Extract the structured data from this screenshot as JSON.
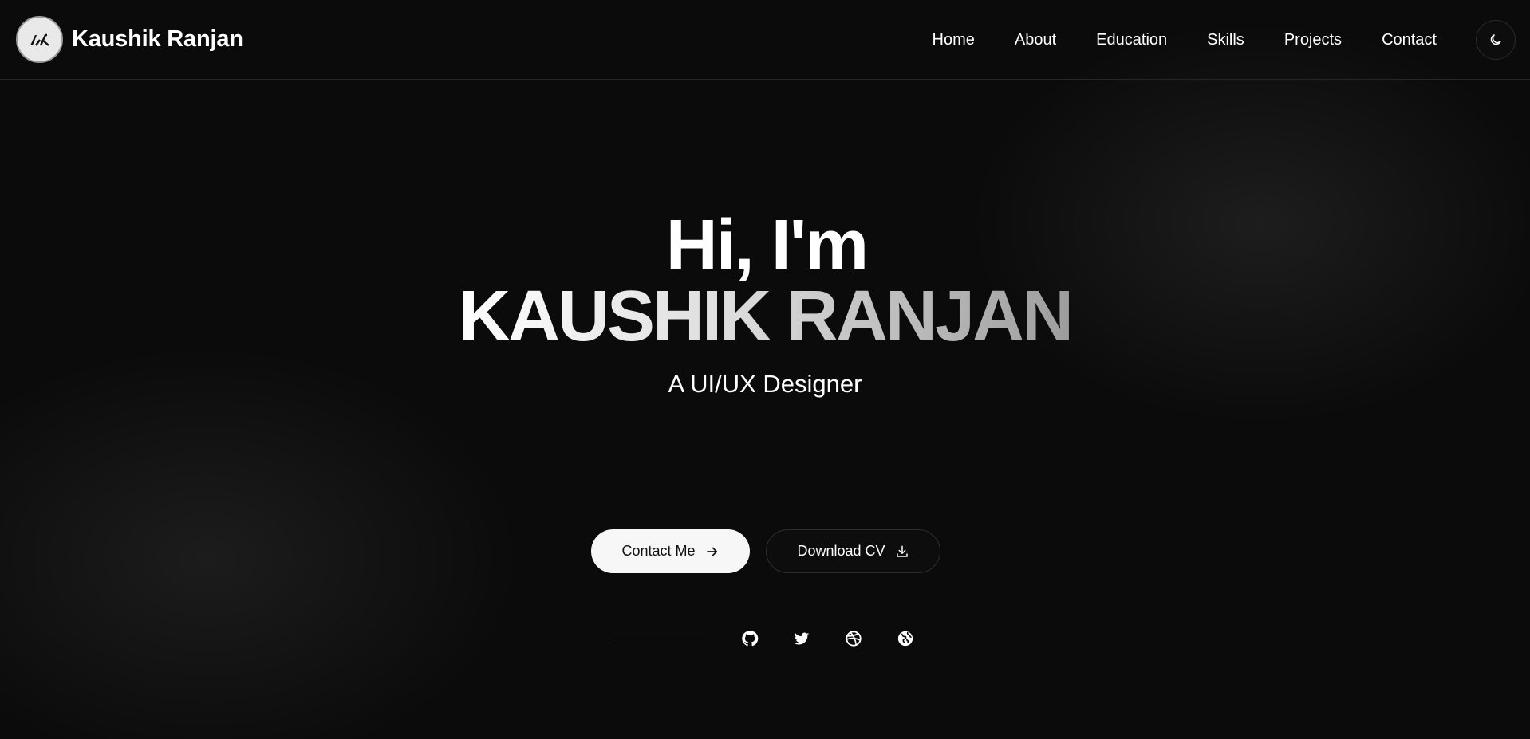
{
  "header": {
    "brand_name": "Kaushik Ranjan",
    "logo_mark": "K",
    "nav": [
      {
        "label": "Home"
      },
      {
        "label": "About"
      },
      {
        "label": "Education"
      },
      {
        "label": "Skills"
      },
      {
        "label": "Projects"
      },
      {
        "label": "Contact"
      }
    ],
    "theme_toggle_icon": "moon-icon"
  },
  "hero": {
    "greeting": "Hi, I'm",
    "name": "KAUSHIK RANJAN",
    "role": "A UI/UX Designer",
    "buttons": {
      "contact_label": "Contact Me",
      "contact_icon": "arrow-right-icon",
      "cv_label": "Download CV",
      "cv_icon": "download-icon"
    }
  },
  "social": [
    {
      "icon": "github-icon"
    },
    {
      "icon": "twitter-icon"
    },
    {
      "icon": "dribbble-icon"
    },
    {
      "icon": "globe-icon"
    }
  ],
  "colors": {
    "background": "#0b0b0b",
    "text": "#ffffff",
    "button_light": "#f7f7f7",
    "border": "#2e2e2e"
  }
}
